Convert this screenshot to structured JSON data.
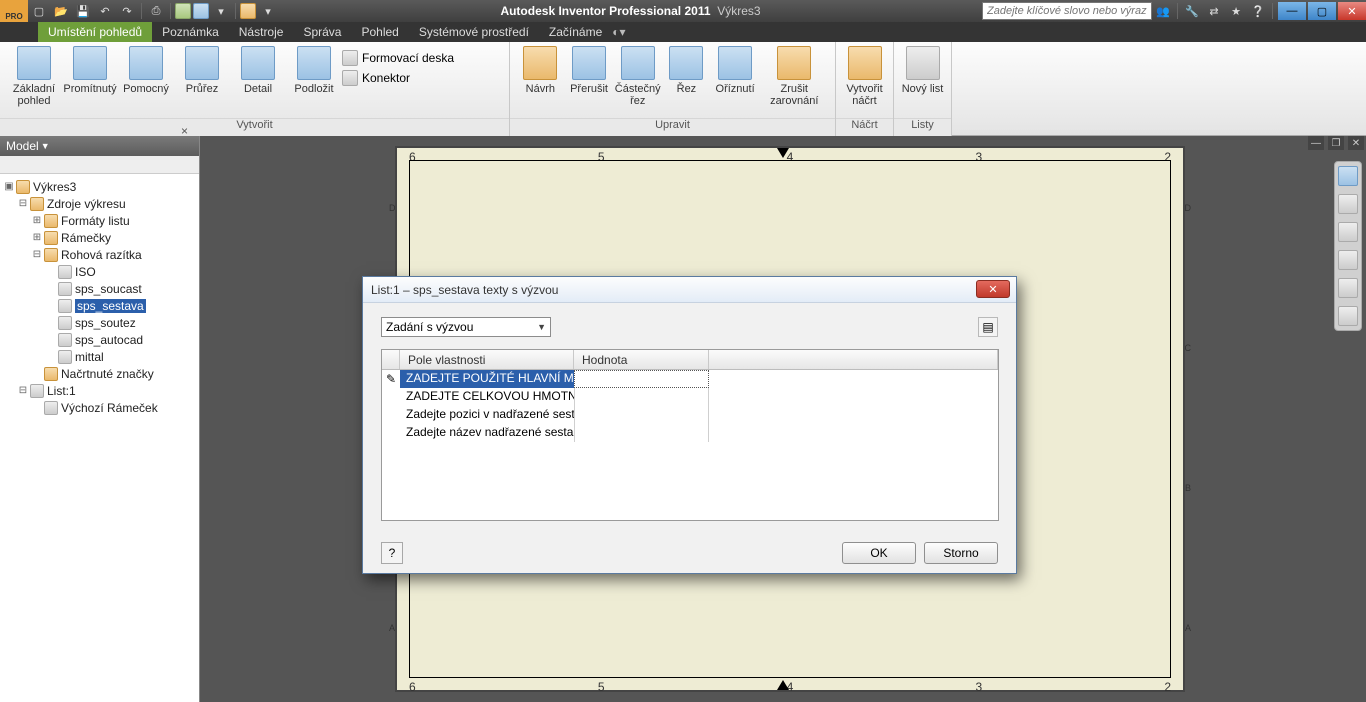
{
  "app": {
    "title": "Autodesk Inventor Professional 2011",
    "doc": "Výkres3"
  },
  "search": {
    "placeholder": "Zadejte klíčové slovo nebo výraz."
  },
  "tabs": {
    "items": [
      "Umístění pohledů",
      "Poznámka",
      "Nástroje",
      "Správa",
      "Pohled",
      "Systémové prostředí",
      "Začínáme"
    ],
    "active": 0
  },
  "ribbon": {
    "panel1": {
      "label": "Vytvořit",
      "btns": [
        "Základní pohled",
        "Promítnutý",
        "Pomocný",
        "Průřez",
        "Detail",
        "Podložit"
      ],
      "side": [
        "Formovací deska",
        "Konektor"
      ]
    },
    "panel2": {
      "label": "Upravit",
      "btns": [
        "Návrh",
        "Přerušit",
        "Částečný řez",
        "Řez",
        "Oříznutí",
        "Zrušit zarovnání"
      ]
    },
    "panel3": {
      "label": "Náčrt",
      "btns": [
        "Vytvořit náčrt"
      ]
    },
    "panel4": {
      "label": "Listy",
      "btns": [
        "Nový list"
      ]
    }
  },
  "browser": {
    "title": "Model",
    "root": "Výkres3",
    "n1": "Zdroje výkresu",
    "n2": "Formáty listu",
    "n3": "Rámečky",
    "n4": "Rohová razítka",
    "leaf": [
      "ISO",
      "sps_soucast",
      "sps_sestava",
      "sps_soutez",
      "sps_autocad",
      "mittal"
    ],
    "selectedLeaf": 2,
    "n5": "Načrtnuté značky",
    "n6": "List:1",
    "n7": "Výchozí Rámeček"
  },
  "ruler": {
    "top": [
      "6",
      "5",
      "4",
      "3",
      "2"
    ],
    "bottom": [
      "6",
      "5",
      "4",
      "3",
      "2"
    ],
    "left": [
      "D",
      "C",
      "B",
      "A"
    ],
    "right": [
      "D",
      "C",
      "B",
      "A"
    ]
  },
  "dialog": {
    "title": "List:1 – sps_sestava texty s výzvou",
    "combo": "Zadání s výzvou",
    "cols": [
      "Pole vlastnosti",
      "Hodnota"
    ],
    "rows": [
      "ZADEJTE POUŽITÉ HLAVNÍ MĚŘ",
      "ZADEJTE CELKOVOU HMOTNOS",
      "Zadejte pozici v nadřazené sest",
      "Zadejte název nadřazené sesta"
    ],
    "ok": "OK",
    "cancel": "Storno"
  }
}
